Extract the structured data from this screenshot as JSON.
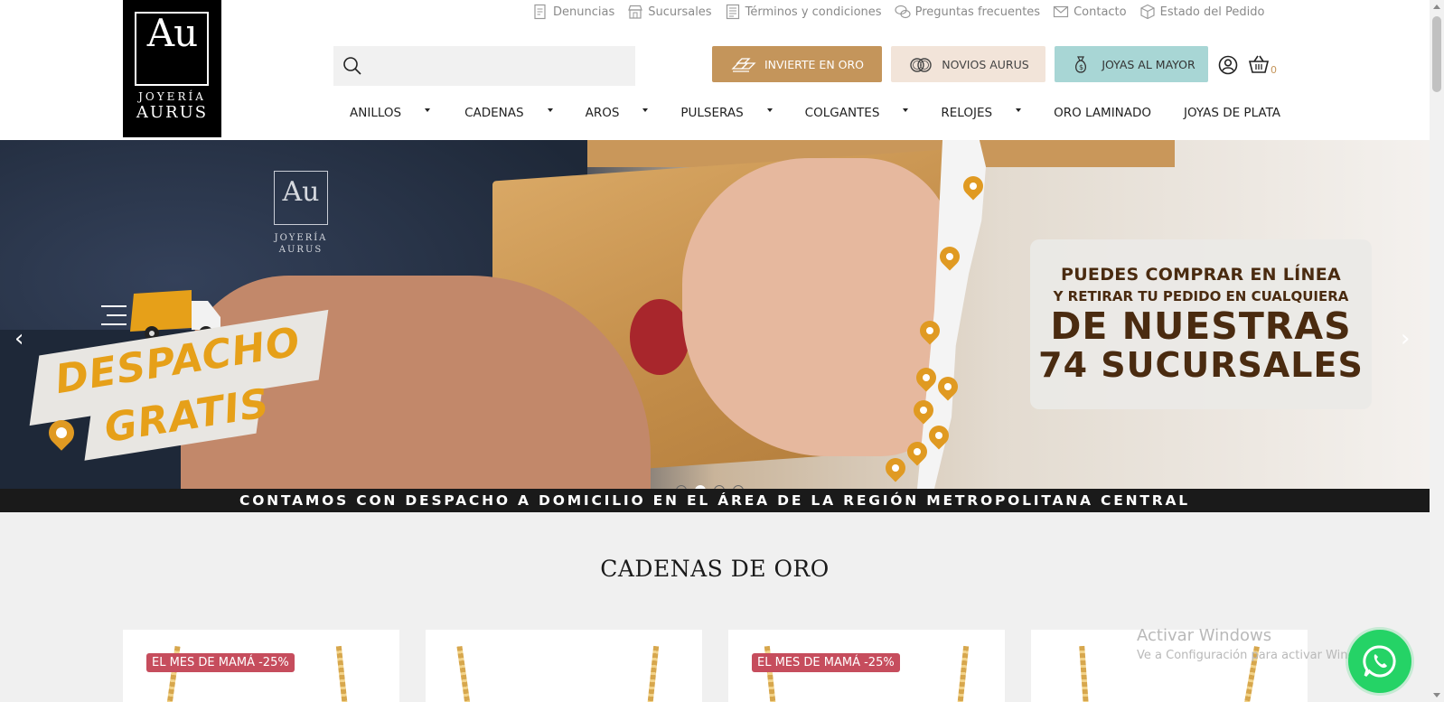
{
  "logo": {
    "mark": "Au",
    "line1": "JOYERÍA",
    "line2": "AURUS"
  },
  "toplinks": [
    {
      "label": "Denuncias",
      "icon": "report-icon"
    },
    {
      "label": "Sucursales",
      "icon": "store-icon"
    },
    {
      "label": "Términos y condiciones",
      "icon": "document-icon"
    },
    {
      "label": "Preguntas frecuentes",
      "icon": "faq-icon"
    },
    {
      "label": "Contacto",
      "icon": "mail-icon"
    },
    {
      "label": "Estado del Pedido",
      "icon": "package-icon"
    }
  ],
  "search": {
    "placeholder": ""
  },
  "cta": {
    "oro": "INVIERTE EN ORO",
    "novios": "NOVIOS AURUS",
    "mayor": "JOYAS AL MAYOR"
  },
  "cart": {
    "count": "0"
  },
  "nav": [
    {
      "label": "ANILLOS",
      "dropdown": true
    },
    {
      "label": "CADENAS",
      "dropdown": true
    },
    {
      "label": "AROS",
      "dropdown": true
    },
    {
      "label": "PULSERAS",
      "dropdown": true
    },
    {
      "label": "COLGANTES",
      "dropdown": true
    },
    {
      "label": "RELOJES",
      "dropdown": true
    },
    {
      "label": "ORO LAMINADO",
      "dropdown": false
    },
    {
      "label": "JOYAS DE PLATA",
      "dropdown": false
    }
  ],
  "banner": {
    "shirt_logo_mark": "Au",
    "shirt_logo_line1": "JOYERÍA",
    "shirt_logo_line2": "AURUS",
    "promo_line1": "DESPACHO",
    "promo_line2": "GRATIS",
    "msg_line1": "PUEDES COMPRAR EN LÍNEA",
    "msg_line2": "Y RETIRAR TU PEDIDO EN CUALQUIERA",
    "msg_line3": "DE NUESTRAS",
    "msg_line4": "74 SUCURSALES",
    "strip": "CONTAMOS CON DESPACHO A DOMICILIO EN EL ÁREA DE LA REGIÓN METROPOLITANA CENTRAL",
    "prev_arrow": "‹",
    "next_arrow": "›",
    "active_slide": 2,
    "slide_count": 4
  },
  "section_title": "CADENAS DE ORO",
  "products": [
    {
      "badge": "EL MES DE MAMÁ -25%"
    },
    {
      "badge": ""
    },
    {
      "badge": "EL MES DE MAMÁ -25%"
    },
    {
      "badge": ""
    }
  ],
  "watermark": {
    "line1": "Activar Windows",
    "line2": "Ve a Configuración para activar Windows."
  },
  "colors": {
    "oro_button": "#c4955b",
    "novios_button": "#f2e4d9",
    "mayor_button": "#a8d6d5",
    "badge": "#c64d5d",
    "promo_yellow": "#e6a019",
    "whatsapp": "#25d366"
  }
}
